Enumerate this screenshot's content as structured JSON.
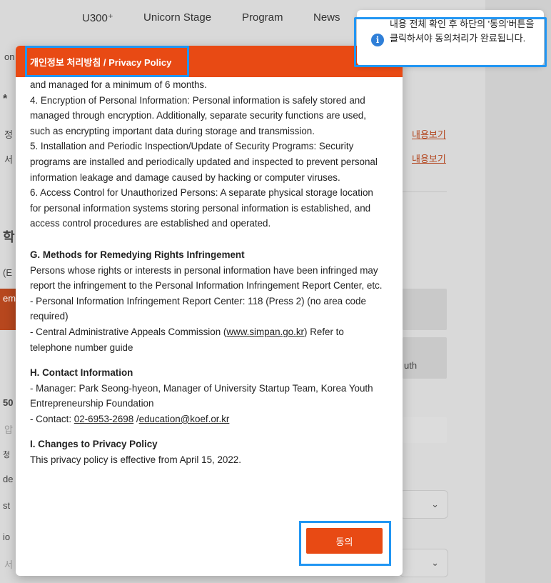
{
  "nav": {
    "items": [
      "U300⁺",
      "Unicorn Stage",
      "Program",
      "News"
    ]
  },
  "background": {
    "frag_on": "on",
    "frag_1": "*",
    "frag_2": "정",
    "frag_3": "서",
    "link_1": "내용보기",
    "link_2": "내용보기",
    "frag_hak": "학",
    "frag_ec": "(E",
    "frag_em": "em",
    "frag_uth": "uth",
    "frag_50": "50",
    "frag_ap": "압",
    "frag_chung": "청",
    "frag_de": "de",
    "frag_st": "st",
    "frag_io": "io",
    "frag_seoul": "서"
  },
  "toast": {
    "icon": "info-icon",
    "message": "내용 전체 확인 후 하단의 '동의'버튼을 클릭하셔야 동의처리가 완료됩니다."
  },
  "modal": {
    "title": "개인정보 처리방침 / Privacy Policy",
    "p1": "and managed for a minimum of 6 months.",
    "p2": "4. Encryption of Personal Information: Personal information is safely stored and managed through encryption. Additionally, separate security functions are used, such as encrypting important data during storage and transmission.",
    "p3": "5. Installation and Periodic Inspection/Update of Security Programs: Security programs are installed and periodically updated and inspected to prevent personal information leakage and damage caused by hacking or computer viruses.",
    "p4": "6. Access Control for Unauthorized Persons: A separate physical storage location for personal information systems storing personal information is established, and access control procedures are established and operated.",
    "g_heading": "G. Methods for Remedying Rights Infringement",
    "g_p1": "Persons whose rights or interests in personal information have been infringed may report the infringement to the Personal Information Infringement Report Center, etc.",
    "g_p2": "- Personal Information Infringement Report Center: 118 (Press 2) (no area code required)",
    "g_p3_pre": "- Central Administrative Appeals Commission (",
    "g_p3_link": "www.simpan.go.kr",
    "g_p3_post": ") Refer to telephone number guide",
    "h_heading": "H. Contact Information",
    "h_p1": "- Manager: Park Seong-hyeon, Manager of University Startup Team, Korea Youth Entrepreneurship Foundation",
    "h_p2_pre": "- Contact: ",
    "h_phone": "02-6953-2698",
    "h_sep": " /",
    "h_email": "education@koef.or.kr",
    "i_heading": "I. Changes to Privacy Policy",
    "i_p1": "This privacy policy is effective from April 15, 2022.",
    "agree_label": "동의"
  },
  "colors": {
    "accent": "#e84a14",
    "highlight": "#2196f3",
    "info": "#2f7fd8"
  }
}
